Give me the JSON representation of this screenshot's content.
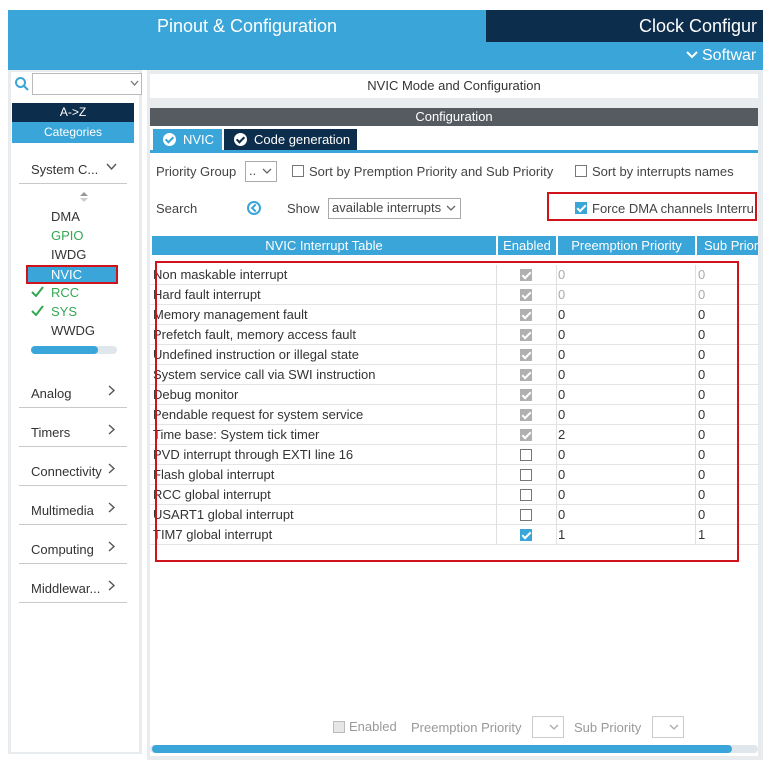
{
  "header": {
    "pinout_tab": "Pinout & Configuration",
    "clock_tab": "Clock Configur",
    "software_label": "Softwar"
  },
  "sidebar": {
    "search_value": "",
    "az_label": "A->Z",
    "categories_label": "Categories",
    "system_core": {
      "label": "System C...",
      "items": [
        {
          "label": "DMA",
          "status": "none"
        },
        {
          "label": "GPIO",
          "status": "green"
        },
        {
          "label": "IWDG",
          "status": "none"
        },
        {
          "label": "NVIC",
          "status": "selected"
        },
        {
          "label": "RCC",
          "status": "check"
        },
        {
          "label": "SYS",
          "status": "check"
        },
        {
          "label": "WWDG",
          "status": "none"
        }
      ]
    },
    "sections": [
      "Analog",
      "Timers",
      "Connectivity",
      "Multimedia",
      "Computing",
      "Middlewar..."
    ]
  },
  "main": {
    "mode_title": "NVIC Mode and Configuration",
    "configuration_label": "Configuration",
    "tabs": [
      {
        "label": "NVIC"
      },
      {
        "label": "Code generation"
      }
    ],
    "priority_group_label": "Priority Group",
    "priority_group_value": "..",
    "sort_preemption_label": "Sort by Premption Priority and Sub Priority",
    "sort_names_label": "Sort by interrupts names",
    "search_label": "Search",
    "show_label": "Show",
    "show_value": "available interrupts",
    "force_dma_label": "Force DMA channels Interru",
    "table": {
      "headers": [
        "NVIC Interrupt Table",
        "Enabled",
        "Preemption Priority",
        "Sub Prior"
      ],
      "rows": [
        {
          "name": "Non maskable interrupt",
          "enabled": "locked",
          "preemption": "0",
          "sub": "0",
          "disabled_values": true
        },
        {
          "name": "Hard fault interrupt",
          "enabled": "locked",
          "preemption": "0",
          "sub": "0",
          "disabled_values": true
        },
        {
          "name": "Memory management fault",
          "enabled": "locked",
          "preemption": "0",
          "sub": "0",
          "disabled_values": false
        },
        {
          "name": "Prefetch fault, memory access fault",
          "enabled": "locked",
          "preemption": "0",
          "sub": "0",
          "disabled_values": false
        },
        {
          "name": "Undefined instruction or illegal state",
          "enabled": "locked",
          "preemption": "0",
          "sub": "0",
          "disabled_values": false
        },
        {
          "name": "System service call via SWI instruction",
          "enabled": "locked",
          "preemption": "0",
          "sub": "0",
          "disabled_values": false
        },
        {
          "name": "Debug monitor",
          "enabled": "locked",
          "preemption": "0",
          "sub": "0",
          "disabled_values": false
        },
        {
          "name": "Pendable request for system service",
          "enabled": "locked",
          "preemption": "0",
          "sub": "0",
          "disabled_values": false
        },
        {
          "name": "Time base: System tick timer",
          "enabled": "locked",
          "preemption": "2",
          "sub": "0",
          "disabled_values": false
        },
        {
          "name": "PVD interrupt through EXTI line 16",
          "enabled": "off",
          "preemption": "0",
          "sub": "0",
          "disabled_values": false
        },
        {
          "name": "Flash global interrupt",
          "enabled": "off",
          "preemption": "0",
          "sub": "0",
          "disabled_values": false
        },
        {
          "name": "RCC global interrupt",
          "enabled": "off",
          "preemption": "0",
          "sub": "0",
          "disabled_values": false
        },
        {
          "name": "USART1 global interrupt",
          "enabled": "off",
          "preemption": "0",
          "sub": "0",
          "disabled_values": false
        },
        {
          "name": "TIM7 global interrupt",
          "enabled": "on",
          "preemption": "1",
          "sub": "1",
          "disabled_values": false
        }
      ]
    },
    "bottom": {
      "enabled_label": "Enabled",
      "preemption_label": "Preemption Priority",
      "sub_priority_label": "Sub Priority"
    }
  },
  "colors": {
    "accent": "#3aa5d9",
    "dark": "#0d2d4c",
    "highlight_box": "#d0121b",
    "green": "#34a853"
  }
}
